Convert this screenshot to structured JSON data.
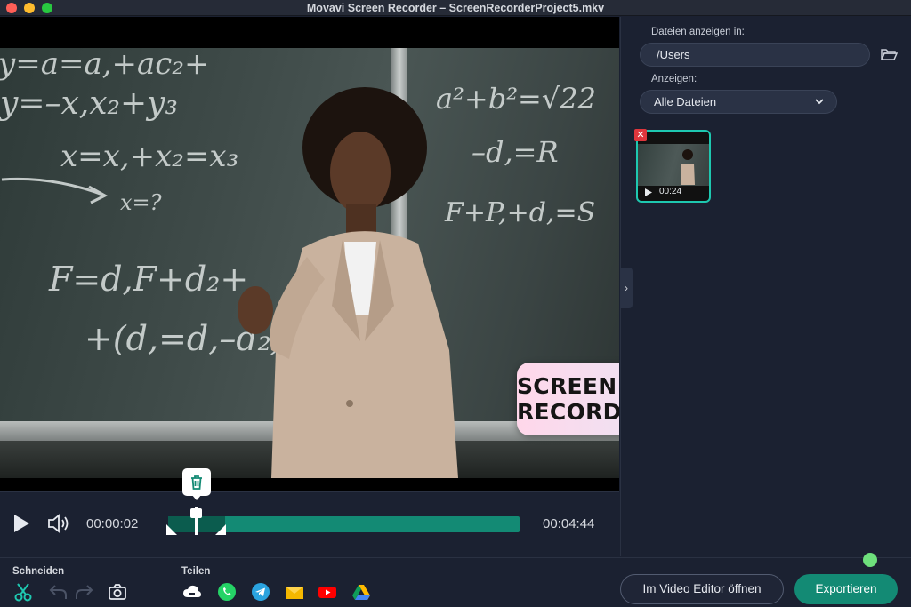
{
  "window": {
    "title": "Movavi Screen Recorder – ScreenRecorderProject5.mkv"
  },
  "preview": {
    "promo_banner": "SCREEN + AUDIO RECORDER",
    "chalkboard": [
      "y=a=a,+ac₂+",
      "y=–x,x₂+y₃",
      "x=x,+x₂=x₃",
      "x=?",
      "F=d,F+d₂+",
      "+(d,=d,–d₂)",
      "a²+b²=√22",
      "–d,=R",
      "F+P,+d,=S"
    ]
  },
  "sidebar": {
    "folder_label": "Dateien anzeigen in:",
    "folder_path": "/Users",
    "filter_label": "Anzeigen:",
    "filter_value": "Alle Dateien",
    "thumbnail": {
      "duration": "00:24"
    }
  },
  "playback": {
    "current_time": "00:00:02",
    "total_time": "00:04:44"
  },
  "toolbar": {
    "cut_label": "Schneiden",
    "share_label": "Teilen",
    "open_editor_label": "Im Video Editor öffnen",
    "export_label": "Exportieren"
  },
  "colors": {
    "accent": "#138a74",
    "accent_dark": "#0b5c4e",
    "background": "#1b2131",
    "delete": "#e0363c",
    "status": "#6ee07c"
  }
}
